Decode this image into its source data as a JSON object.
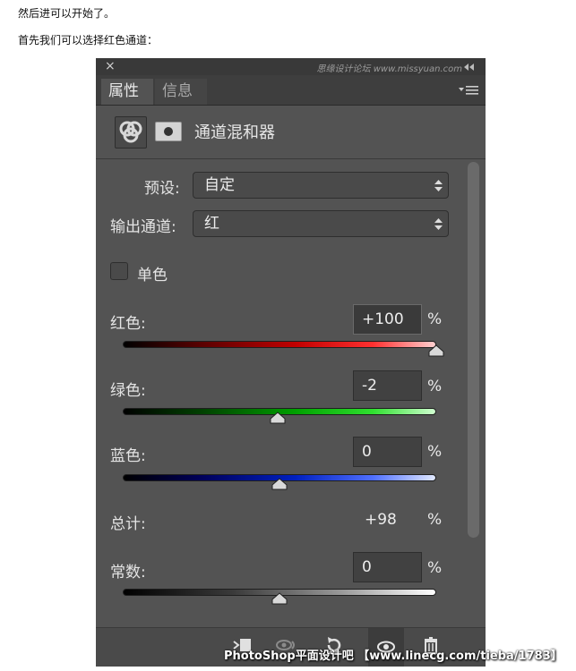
{
  "article": {
    "line1": "然后进可以开始了。",
    "line2": "首先我们可以选择红色通道："
  },
  "panel": {
    "close_glyph": "×",
    "watermark_top": "思缘设计论坛 www.missyuan.com",
    "tabs": [
      {
        "label": "属性",
        "active": true
      },
      {
        "label": "信息",
        "active": false
      }
    ],
    "adjustment_title": "通道混和器",
    "preset": {
      "label": "预设:",
      "value": "自定"
    },
    "output_channel": {
      "label": "输出通道:",
      "value": "红"
    },
    "monochrome": {
      "label": "单色",
      "checked": false
    },
    "sliders": [
      {
        "label": "红色:",
        "value": "+100",
        "percent": "%",
        "level": 200,
        "range": [
          -200,
          200
        ],
        "color": "red"
      },
      {
        "label": "绿色:",
        "value": "-2",
        "percent": "%",
        "level": -2,
        "range": [
          -200,
          200
        ],
        "color": "green"
      },
      {
        "label": "蓝色:",
        "value": "0",
        "percent": "%",
        "level": 0,
        "range": [
          -200,
          200
        ],
        "color": "blue"
      }
    ],
    "total": {
      "label": "总计:",
      "value": "+98",
      "percent": "%"
    },
    "constant": {
      "label": "常数:",
      "value": "0",
      "percent": "%",
      "level": 0,
      "range": [
        -200,
        200
      ]
    },
    "bottom_watermark": "PhotoShop平面设计吧 【www.linecg.com/tieba/1783】"
  },
  "colors": {
    "panel_bg": "#535353",
    "titlebar_bg": "#393939",
    "text": "#e4e4e4"
  },
  "icons": [
    "close-icon",
    "collapse-icon",
    "panel-menu-icon",
    "channel-mixer-icon",
    "layer-mask-icon",
    "select-arrows-icon",
    "clip-to-layer-icon",
    "view-previous-icon",
    "reset-icon",
    "visibility-eye-icon",
    "trash-icon"
  ]
}
